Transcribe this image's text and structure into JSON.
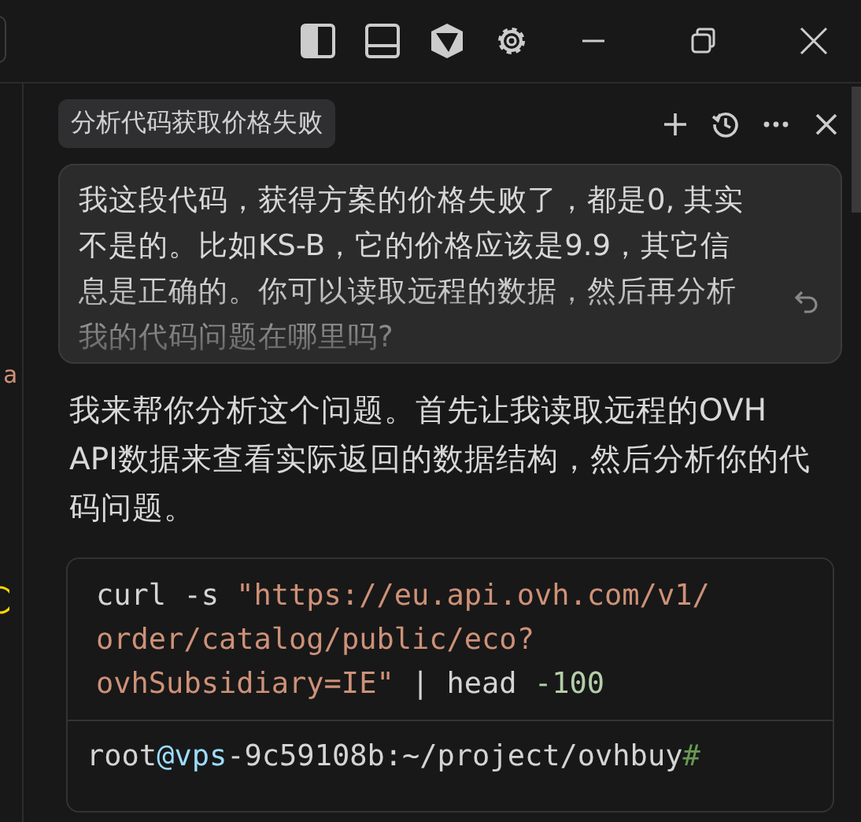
{
  "editor_edge": {
    "texts": [
      {
        "kind": "string",
        "text": "a"
      }
    ]
  },
  "chat": {
    "title": "分析代码获取价格失败",
    "user_message": "我这段代码，获得方案的价格失败了，都是0, 其实不是的。比如KS-B，它的价格应该是9.9，其它信息是正确的。你可以读取远程的数据，然后再分析我的代码问题在哪里吗?",
    "assistant_message": "我来帮你分析这个问题。首先让我读取远程的OVH API数据来查看实际返回的数据结构，然后分析你的代码问题。",
    "command": [
      {
        "kind": "plain",
        "text": "curl -s "
      },
      {
        "kind": "string",
        "text": "\"https://eu.api.ovh.com/v1/order/catalog/public/eco?ovhSubsidiary=IE\""
      },
      {
        "kind": "plain",
        "text": " | head "
      },
      {
        "kind": "number",
        "text": "-100"
      }
    ],
    "prompt": [
      {
        "kind": "plain",
        "text": "root"
      },
      {
        "kind": "host",
        "text": "@vps"
      },
      {
        "kind": "plain",
        "text": "-9c59108b:~/project/ovhbuy"
      },
      {
        "kind": "hash",
        "text": "#"
      }
    ]
  }
}
